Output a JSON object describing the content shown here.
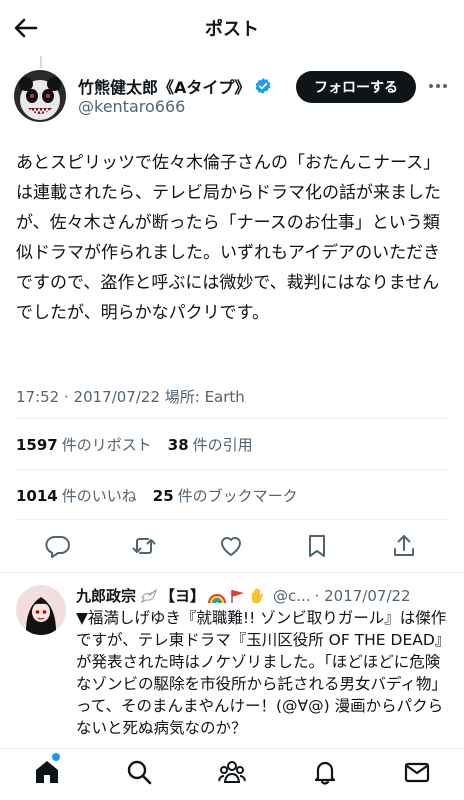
{
  "header": {
    "title": "ポスト"
  },
  "post": {
    "author_name": "竹熊健太郎《Aタイプ》",
    "handle": "@kentaro666",
    "follow_label": "フォローする",
    "text": "あとスピリッツで佐々木倫子さんの「おたんこナース」は連載されたら、テレビ局からドラマ化の話が来ましたが、佐々木さんが断ったら「ナースのお仕事」という類似ドラマが作られました。いずれもアイデアのいただきですので、盗作と呼ぶには微妙で、裁判にはなりませんでしたが、明らかなパクリです。",
    "meta": "17:52 · 2017/07/22 場所: Earth"
  },
  "stats": {
    "reposts_count": "1597",
    "reposts_label": "件のリポスト",
    "quotes_count": "38",
    "quotes_label": "件の引用",
    "likes_count": "1014",
    "likes_label": "件のいいね",
    "bookmarks_count": "25",
    "bookmarks_label": "件のブックマーク"
  },
  "reply": {
    "author_name": "九郎政宗",
    "badge": "【ヨ】",
    "handle": "@c...",
    "date": "· 2017/07/22",
    "text": "▼福満しげゆき『就職難!! ゾンビ取りガール』は傑作ですが、テレ東ドラマ『玉川区役所 OF THE DEAD』が発表された時はノケゾリました。「ほどほどに危険なゾンビの駆除を市役所から託される男女バディ物」って、そのまんまやんけー！(@∀@) 漫画からパクらないと死ぬ病気なのか？"
  },
  "icons": {
    "back": "back-arrow-icon",
    "verified": "verified-badge-icon",
    "more": "more-icon",
    "reply": "reply-icon",
    "repost": "repost-icon",
    "like": "like-icon",
    "bookmark": "bookmark-icon",
    "share": "share-icon",
    "home": "home-icon",
    "search": "search-icon",
    "communities": "communities-icon",
    "notifications": "notifications-icon",
    "messages": "messages-icon"
  },
  "colors": {
    "accent": "#1d9bf0",
    "text": "#0f1419",
    "secondary": "#536471",
    "follow_bg": "#0f1419"
  }
}
